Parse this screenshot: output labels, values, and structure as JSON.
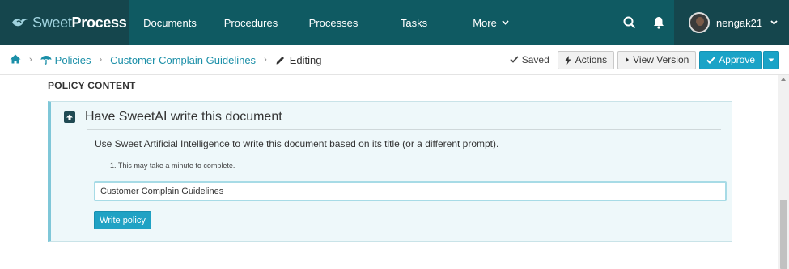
{
  "brand": {
    "part1": "Sweet",
    "part2": "Process",
    "icon": "sweetprocess-logo-icon"
  },
  "nav": {
    "items": [
      {
        "label": "Documents"
      },
      {
        "label": "Procedures"
      },
      {
        "label": "Processes"
      },
      {
        "label": "Tasks"
      },
      {
        "label": "More"
      }
    ],
    "search_icon": "search-icon",
    "bell_icon": "bell-icon"
  },
  "user": {
    "name": "nengak21"
  },
  "breadcrumb": {
    "home_icon": "home-icon",
    "policies": "Policies",
    "doc": "Customer Complain Guidelines",
    "current": "Editing"
  },
  "actions": {
    "saved": "Saved",
    "actions": "Actions",
    "view_version": "View Version",
    "approve": "Approve"
  },
  "content": {
    "section_title": "POLICY CONTENT",
    "ai": {
      "title": "Have SweetAI write this document",
      "description": "Use Sweet Artificial Intelligence to write this document based on its title (or a different prompt).",
      "note": "1. This may take a minute to complete.",
      "input_value": "Customer Complain Guidelines",
      "button": "Write policy"
    }
  },
  "colors": {
    "nav_bg": "#0f5a62",
    "nav_dark": "#15464d",
    "accent": "#1aa3c7",
    "link": "#1b8fa8",
    "panel_bg": "#eef8fa"
  }
}
